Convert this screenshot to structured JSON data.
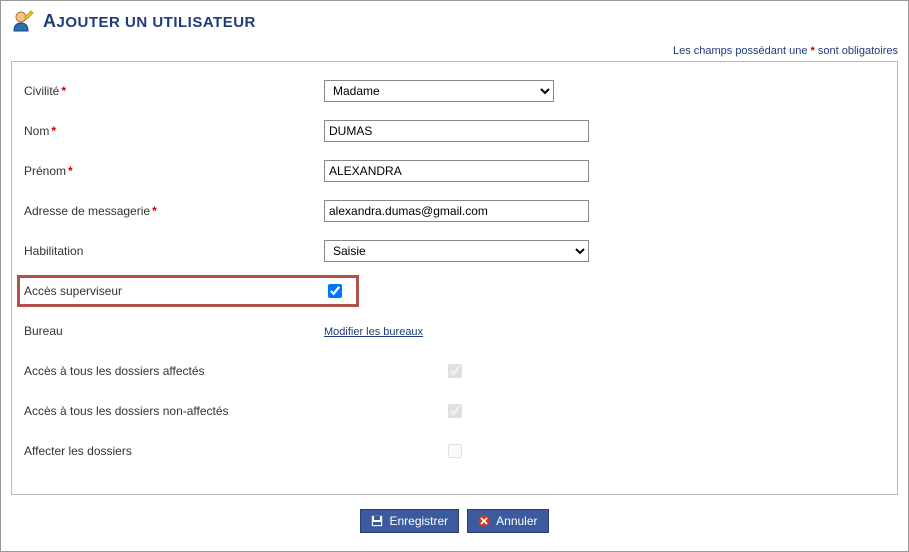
{
  "header": {
    "title_first": "A",
    "title_rest": "JOUTER UN UTILISATEUR"
  },
  "required_note": {
    "prefix": "Les champs possédant une ",
    "suffix": " sont obligatoires"
  },
  "fields": {
    "civilite": {
      "label": "Civilité",
      "value": "Madame"
    },
    "nom": {
      "label": "Nom",
      "value": "DUMAS"
    },
    "prenom": {
      "label": "Prénom",
      "value": "ALEXANDRA"
    },
    "email": {
      "label": "Adresse de messagerie",
      "value": "alexandra.dumas@gmail.com"
    },
    "habilitation": {
      "label": "Habilitation",
      "value": "Saisie"
    },
    "superviseur": {
      "label": "Accès superviseur"
    },
    "bureau": {
      "label": "Bureau",
      "link": "Modifier les bureaux"
    },
    "dossiers_affectes": {
      "label": "Accès à tous les dossiers affectés"
    },
    "dossiers_non_affectes": {
      "label": "Accès à tous les dossiers non-affectés"
    },
    "affecter": {
      "label": "Affecter les dossiers"
    }
  },
  "buttons": {
    "save": "Enregistrer",
    "cancel": "Annuler"
  }
}
